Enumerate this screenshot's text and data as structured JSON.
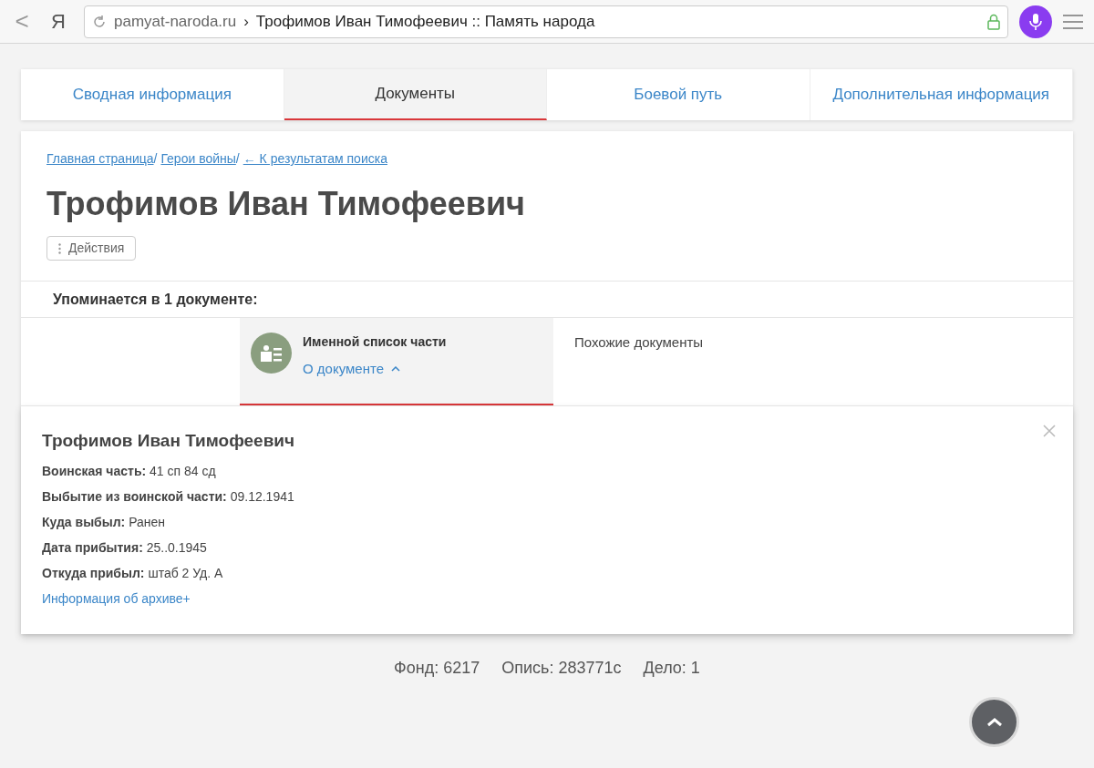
{
  "browser": {
    "back": "<",
    "logo": "Я",
    "url_domain": "pamyat-naroda.ru",
    "url_sep": "›",
    "url_title": "Трофимов Иван Тимофеевич :: Память народа"
  },
  "tabs": [
    {
      "label": "Сводная информация",
      "selected": false
    },
    {
      "label": "Документы",
      "selected": true
    },
    {
      "label": "Боевой путь",
      "selected": false
    },
    {
      "label": "Дополнительная информация",
      "selected": false
    }
  ],
  "breadcrumbs": [
    {
      "label": "Главная страница",
      "separator": "/"
    },
    {
      "label": "Герои войны",
      "separator": "/"
    },
    {
      "label": "← К результатам поиска"
    }
  ],
  "title": "Трофимов Иван Тимофеевич",
  "actions_button": "Действия",
  "mentions": "Упоминается в 1 документе:",
  "documents": [
    {
      "kind": "document",
      "title": "Именной список части",
      "link": "О документе",
      "selected": true
    },
    {
      "kind": "similar",
      "title": "Похожие документы",
      "selected": false
    }
  ],
  "detail": {
    "name": "Трофимов Иван Тимофеевич",
    "fields": [
      "**Воинская часть:** 41 сп 84 сд",
      "**Выбытие из воинской части:** 09.12.1941",
      "**Куда выбыл:** Ранен",
      "**Дата прибытия:** 25..0.1945",
      "**Откуда прибыл:** штаб 2 Уд. А"
    ],
    "archive_link": "Информация об архиве+"
  },
  "archive": [
    "Фонд: 6217",
    "Опись: 283771с",
    "Дело: 1"
  ]
}
